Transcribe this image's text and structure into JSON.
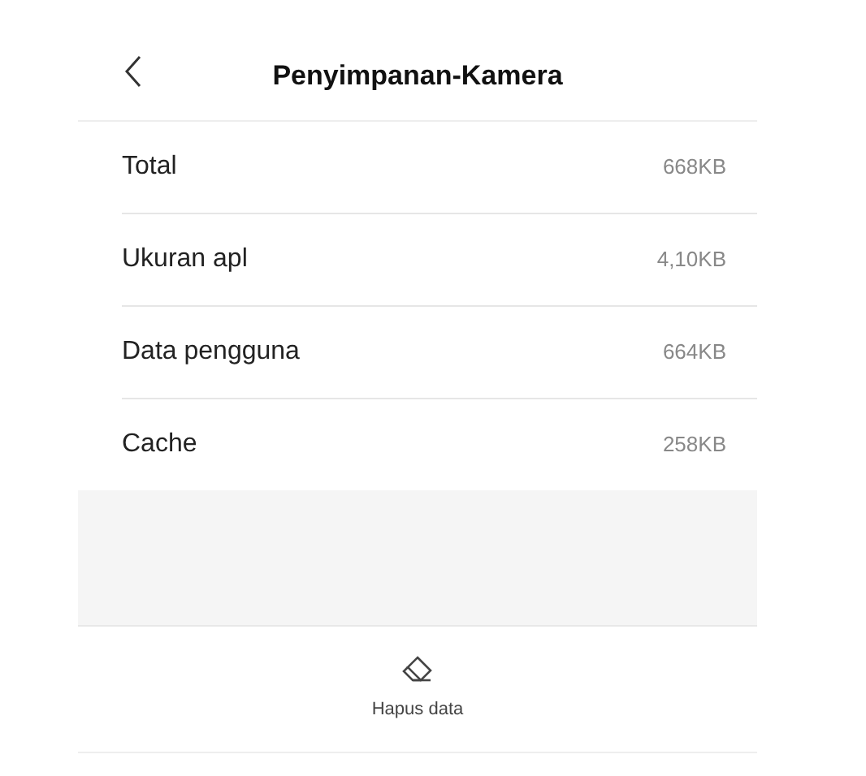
{
  "header": {
    "title": "Penyimpanan-Kamera"
  },
  "rows": [
    {
      "label": "Total",
      "value": "668KB"
    },
    {
      "label": "Ukuran apl",
      "value": "4,10KB"
    },
    {
      "label": "Data pengguna",
      "value": "664KB"
    },
    {
      "label": "Cache",
      "value": "258KB"
    }
  ],
  "actions": [
    {
      "label": "Hapus data"
    }
  ]
}
